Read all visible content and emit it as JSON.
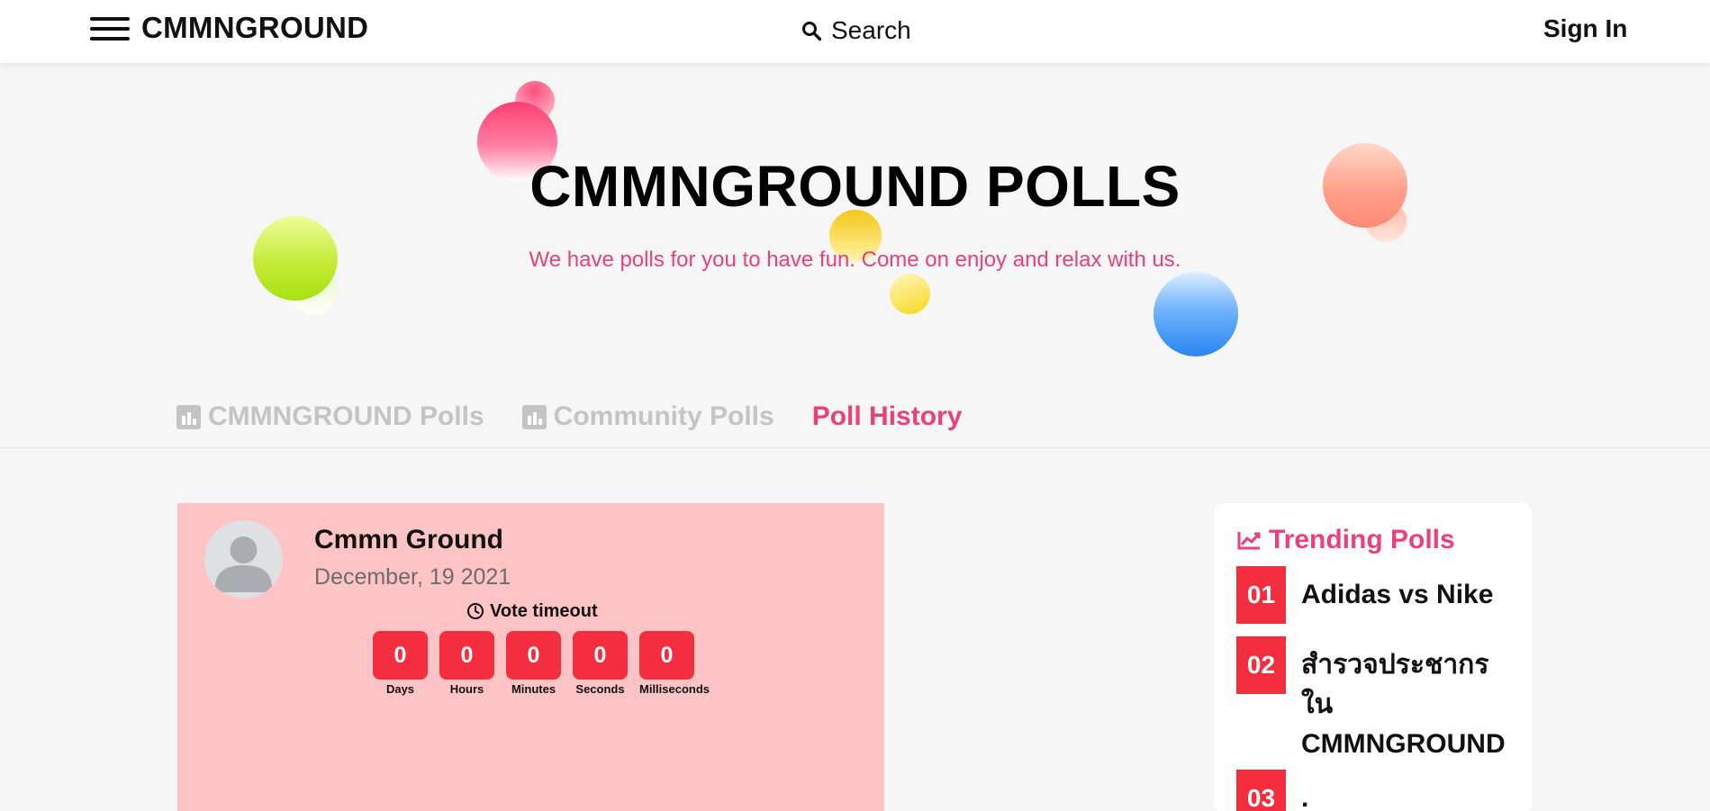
{
  "header": {
    "brand": "CMMNGROUND",
    "search_label": "Search",
    "signin_label": "Sign In"
  },
  "hero": {
    "title": "CMMNGROUND POLLS",
    "subtitle": "We have polls for you to have fun. Come on enjoy and relax with us."
  },
  "tabs": [
    {
      "label": "CMMNGROUND Polls",
      "active": false
    },
    {
      "label": "Community Polls",
      "active": false
    },
    {
      "label": "Poll History",
      "active": true
    }
  ],
  "poll": {
    "author": "Cmmn Ground",
    "date": "December, 19 2021",
    "vote_timeout_label": "Vote timeout",
    "countdown": [
      {
        "value": "0",
        "label": "Days"
      },
      {
        "value": "0",
        "label": "Hours"
      },
      {
        "value": "0",
        "label": "Minutes"
      },
      {
        "value": "0",
        "label": "Seconds"
      },
      {
        "value": "0",
        "label": "Milliseconds"
      }
    ]
  },
  "trending": {
    "title": "Trending Polls",
    "items": [
      {
        "rank": "01",
        "title": "Adidas vs Nike"
      },
      {
        "rank": "02",
        "title": "สำรวจประชากรใน CMMNGROUND"
      },
      {
        "rank": "03",
        "title": "."
      }
    ]
  },
  "colors": {
    "accent_pink": "#ec407a",
    "badge_red": "#f42d3f",
    "card_pink": "#fec3c4",
    "inactive_tab": "#c4c4c4"
  }
}
